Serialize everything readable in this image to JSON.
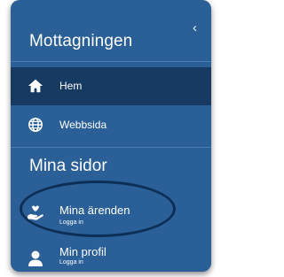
{
  "sidebar": {
    "title": "Mottagningen",
    "collapse_glyph": "‹",
    "nav": [
      {
        "label": "Hem",
        "icon": "home-icon",
        "active": true
      },
      {
        "label": "Webbsida",
        "icon": "globe-icon",
        "active": false
      }
    ],
    "section_title": "Mina sidor",
    "my_pages": [
      {
        "label": "Mina ärenden",
        "sublabel": "Logga in",
        "icon": "care-hand-icon"
      },
      {
        "label": "Min profil",
        "sublabel": "Logga in",
        "icon": "person-icon"
      }
    ]
  },
  "colors": {
    "panel": "#2a5f97",
    "active_row": "#163a61",
    "highlight_ring": "#0d2f55"
  }
}
